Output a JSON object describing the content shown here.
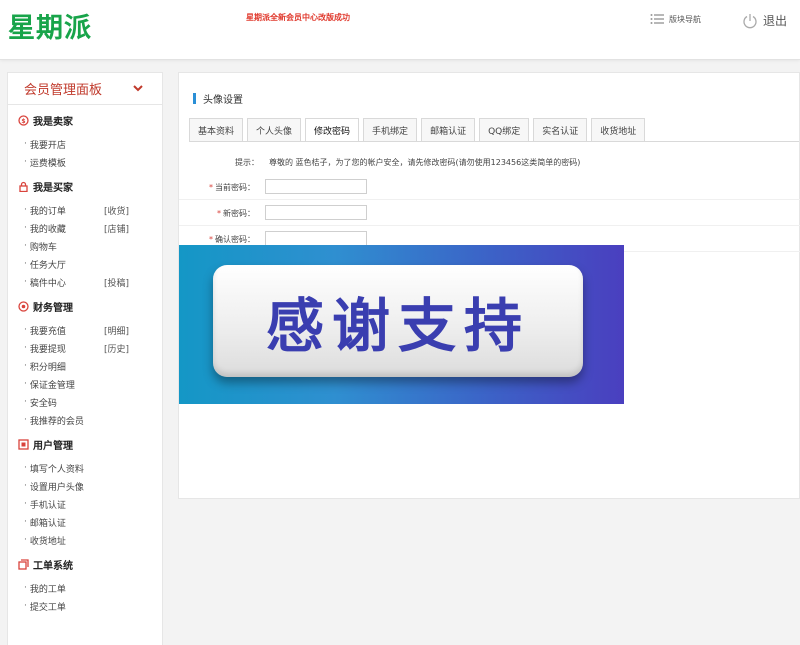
{
  "header": {
    "logo": "星期派",
    "notice": "星期派全新会员中心改版成功",
    "nav_label": "版块导航",
    "logout_label": "退出"
  },
  "sidebar": {
    "panel_title": "会员管理面板",
    "sections": [
      {
        "title": "我是卖家",
        "icon": "seller-icon",
        "items": [
          {
            "label": "我要开店",
            "tag": ""
          },
          {
            "label": "运费模板",
            "tag": ""
          }
        ]
      },
      {
        "title": "我是买家",
        "icon": "lock-icon",
        "items": [
          {
            "label": "我的订单",
            "tag": "[收货]"
          },
          {
            "label": "我的收藏",
            "tag": "[店铺]"
          },
          {
            "label": "购物车",
            "tag": ""
          },
          {
            "label": "任务大厅",
            "tag": ""
          },
          {
            "label": "稿件中心",
            "tag": "[投稿]"
          }
        ]
      },
      {
        "title": "财务管理",
        "icon": "finance-icon",
        "items": [
          {
            "label": "我要充值",
            "tag": "[明细]"
          },
          {
            "label": "我要提现",
            "tag": "[历史]"
          },
          {
            "label": "积分明细",
            "tag": ""
          },
          {
            "label": "保证金管理",
            "tag": ""
          },
          {
            "label": "安全码",
            "tag": ""
          },
          {
            "label": "我推荐的会员",
            "tag": ""
          }
        ]
      },
      {
        "title": "用户管理",
        "icon": "user-manage-icon",
        "items": [
          {
            "label": "填写个人资料",
            "tag": ""
          },
          {
            "label": "设置用户头像",
            "tag": ""
          },
          {
            "label": "手机认证",
            "tag": ""
          },
          {
            "label": "邮箱认证",
            "tag": ""
          },
          {
            "label": "收货地址",
            "tag": ""
          }
        ]
      },
      {
        "title": "工单系统",
        "icon": "ticket-icon",
        "items": [
          {
            "label": "我的工单",
            "tag": ""
          },
          {
            "label": "提交工单",
            "tag": ""
          }
        ]
      }
    ]
  },
  "main": {
    "title": "头像设置",
    "tabs": [
      "基本资料",
      "个人头像",
      "修改密码",
      "手机绑定",
      "邮箱认证",
      "QQ绑定",
      "实名认证",
      "收货地址"
    ],
    "active_tab": 2,
    "tip_label": "提示：",
    "tip_text": "尊敬的 蓝色桔子，为了您的帐户安全，请先修改密码(请勿使用123456这类简单的密码)",
    "fields": [
      {
        "label": "当前密码：",
        "value": ""
      },
      {
        "label": "新密码：",
        "value": ""
      },
      {
        "label": "确认密码：",
        "value": ""
      }
    ]
  },
  "banner": {
    "text": "感谢支持"
  },
  "colors": {
    "brand": "#18a44a",
    "notice": "#e03a2e",
    "panel_title": "#c0392b",
    "accent_bar": "#2a8fd6"
  }
}
